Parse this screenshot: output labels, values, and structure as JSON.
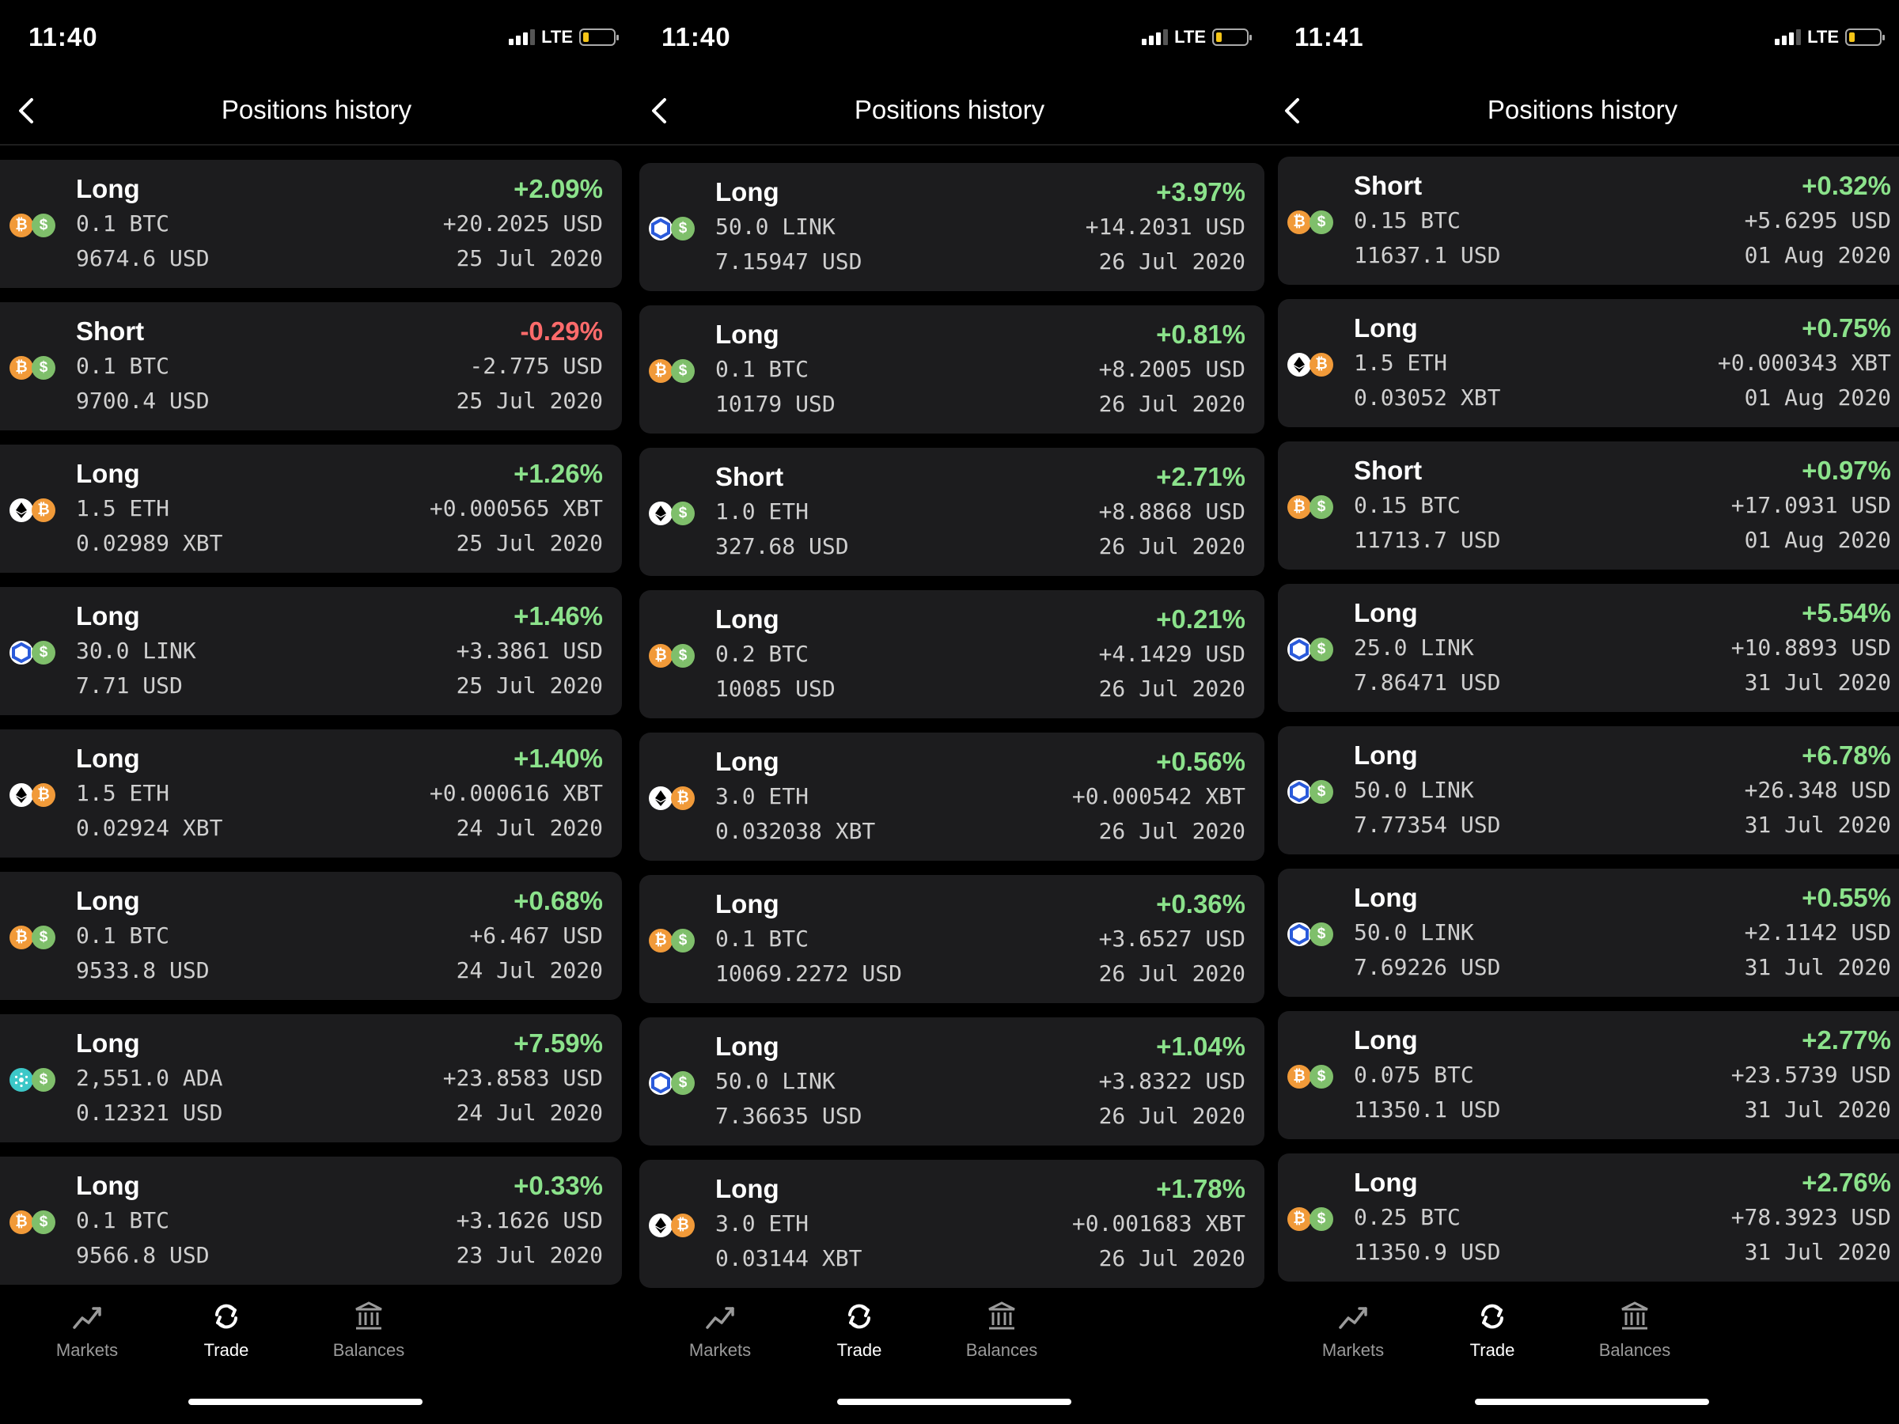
{
  "colors": {
    "positive": "#8be28b",
    "negative": "#ff6b6b",
    "card_bg": "#1c1c1e",
    "btc": "#f19a39",
    "usd": "#7fbf6b",
    "link": "#2a5ada",
    "ada": "#3cc8c8"
  },
  "nav": {
    "title": "Positions history"
  },
  "tabs": [
    {
      "label": "Markets",
      "icon": "markets-chart-icon"
    },
    {
      "label": "Trade",
      "icon": "trade-refresh-icon"
    },
    {
      "label": "Balances",
      "icon": "balances-bank-icon"
    }
  ],
  "panels": [
    {
      "time": "11:40",
      "network": "LTE",
      "positions": [
        {
          "side": "Long",
          "qty": "0.1 BTC",
          "price": "9674.6 USD",
          "pct": "+2.09%",
          "pnl": "+20.2025 USD",
          "date": "25 Jul 2020",
          "coins": [
            "btc",
            "usd"
          ]
        },
        {
          "side": "Short",
          "qty": "0.1 BTC",
          "price": "9700.4 USD",
          "pct": "-0.29%",
          "pnl": "-2.775 USD",
          "date": "25 Jul 2020",
          "coins": [
            "btc",
            "usd"
          ]
        },
        {
          "side": "Long",
          "qty": "1.5 ETH",
          "price": "0.02989 XBT",
          "pct": "+1.26%",
          "pnl": "+0.000565 XBT",
          "date": "25 Jul 2020",
          "coins": [
            "eth",
            "btc"
          ]
        },
        {
          "side": "Long",
          "qty": "30.0 LINK",
          "price": "7.71 USD",
          "pct": "+1.46%",
          "pnl": "+3.3861 USD",
          "date": "25 Jul 2020",
          "coins": [
            "link",
            "usd"
          ]
        },
        {
          "side": "Long",
          "qty": "1.5 ETH",
          "price": "0.02924 XBT",
          "pct": "+1.40%",
          "pnl": "+0.000616 XBT",
          "date": "24 Jul 2020",
          "coins": [
            "eth",
            "btc"
          ]
        },
        {
          "side": "Long",
          "qty": "0.1 BTC",
          "price": "9533.8 USD",
          "pct": "+0.68%",
          "pnl": "+6.467 USD",
          "date": "24 Jul 2020",
          "coins": [
            "btc",
            "usd"
          ]
        },
        {
          "side": "Long",
          "qty": "2,551.0 ADA",
          "price": "0.12321 USD",
          "pct": "+7.59%",
          "pnl": "+23.8583 USD",
          "date": "24 Jul 2020",
          "coins": [
            "ada",
            "usd"
          ]
        },
        {
          "side": "Long",
          "qty": "0.1 BTC",
          "price": "9566.8 USD",
          "pct": "+0.33%",
          "pnl": "+3.1626 USD",
          "date": "23 Jul 2020",
          "coins": [
            "btc",
            "usd"
          ]
        }
      ]
    },
    {
      "time": "11:40",
      "network": "LTE",
      "positions": [
        {
          "side": "Long",
          "qty": "50.0 LINK",
          "price": "7.15947 USD",
          "pct": "+3.97%",
          "pnl": "+14.2031 USD",
          "date": "26 Jul 2020",
          "coins": [
            "link",
            "usd"
          ]
        },
        {
          "side": "Long",
          "qty": "0.1 BTC",
          "price": "10179 USD",
          "pct": "+0.81%",
          "pnl": "+8.2005 USD",
          "date": "26 Jul 2020",
          "coins": [
            "btc",
            "usd"
          ]
        },
        {
          "side": "Short",
          "qty": "1.0 ETH",
          "price": "327.68 USD",
          "pct": "+2.71%",
          "pnl": "+8.8868 USD",
          "date": "26 Jul 2020",
          "coins": [
            "eth",
            "usd"
          ]
        },
        {
          "side": "Long",
          "qty": "0.2 BTC",
          "price": "10085 USD",
          "pct": "+0.21%",
          "pnl": "+4.1429 USD",
          "date": "26 Jul 2020",
          "coins": [
            "btc",
            "usd"
          ]
        },
        {
          "side": "Long",
          "qty": "3.0 ETH",
          "price": "0.032038 XBT",
          "pct": "+0.56%",
          "pnl": "+0.000542 XBT",
          "date": "26 Jul 2020",
          "coins": [
            "eth",
            "btc"
          ]
        },
        {
          "side": "Long",
          "qty": "0.1 BTC",
          "price": "10069.2272 USD",
          "pct": "+0.36%",
          "pnl": "+3.6527 USD",
          "date": "26 Jul 2020",
          "coins": [
            "btc",
            "usd"
          ]
        },
        {
          "side": "Long",
          "qty": "50.0 LINK",
          "price": "7.36635 USD",
          "pct": "+1.04%",
          "pnl": "+3.8322 USD",
          "date": "26 Jul 2020",
          "coins": [
            "link",
            "usd"
          ]
        },
        {
          "side": "Long",
          "qty": "3.0 ETH",
          "price": "0.03144 XBT",
          "pct": "+1.78%",
          "pnl": "+0.001683 XBT",
          "date": "26 Jul 2020",
          "coins": [
            "eth",
            "btc"
          ]
        }
      ]
    },
    {
      "time": "11:41",
      "network": "LTE",
      "positions": [
        {
          "side": "Short",
          "qty": "0.15 BTC",
          "price": "11637.1 USD",
          "pct": "+0.32%",
          "pnl": "+5.6295 USD",
          "date": "01 Aug 2020",
          "coins": [
            "btc",
            "usd"
          ]
        },
        {
          "side": "Long",
          "qty": "1.5 ETH",
          "price": "0.03052 XBT",
          "pct": "+0.75%",
          "pnl": "+0.000343 XBT",
          "date": "01 Aug 2020",
          "coins": [
            "eth",
            "btc"
          ]
        },
        {
          "side": "Short",
          "qty": "0.15 BTC",
          "price": "11713.7 USD",
          "pct": "+0.97%",
          "pnl": "+17.0931 USD",
          "date": "01 Aug 2020",
          "coins": [
            "btc",
            "usd"
          ]
        },
        {
          "side": "Long",
          "qty": "25.0 LINK",
          "price": "7.86471 USD",
          "pct": "+5.54%",
          "pnl": "+10.8893 USD",
          "date": "31 Jul 2020",
          "coins": [
            "link",
            "usd"
          ]
        },
        {
          "side": "Long",
          "qty": "50.0 LINK",
          "price": "7.77354 USD",
          "pct": "+6.78%",
          "pnl": "+26.348 USD",
          "date": "31 Jul 2020",
          "coins": [
            "link",
            "usd"
          ]
        },
        {
          "side": "Long",
          "qty": "50.0 LINK",
          "price": "7.69226 USD",
          "pct": "+0.55%",
          "pnl": "+2.1142 USD",
          "date": "31 Jul 2020",
          "coins": [
            "link",
            "usd"
          ]
        },
        {
          "side": "Long",
          "qty": "0.075 BTC",
          "price": "11350.1 USD",
          "pct": "+2.77%",
          "pnl": "+23.5739 USD",
          "date": "31 Jul 2020",
          "coins": [
            "btc",
            "usd"
          ]
        },
        {
          "side": "Long",
          "qty": "0.25 BTC",
          "price": "11350.9 USD",
          "pct": "+2.76%",
          "pnl": "+78.3923 USD",
          "date": "31 Jul 2020",
          "coins": [
            "btc",
            "usd"
          ]
        }
      ]
    }
  ]
}
